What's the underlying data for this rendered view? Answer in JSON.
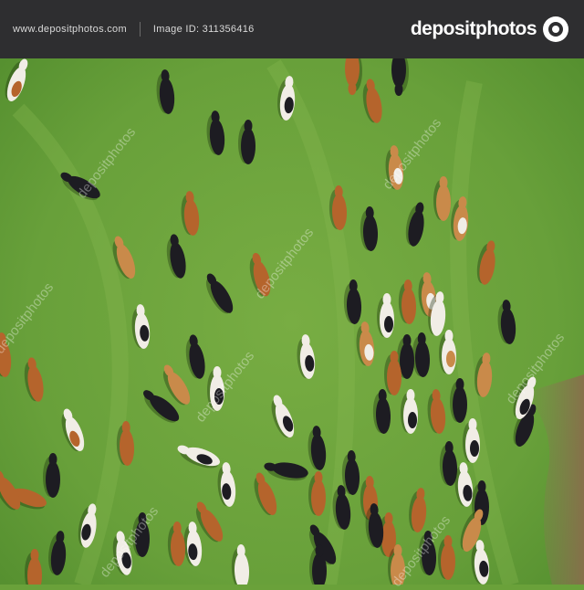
{
  "header": {
    "brand": "depositphotos",
    "image_id": "Image ID: 311356416",
    "site_url": "www.depositphotos.com"
  },
  "watermark": {
    "text": "depositphotos"
  },
  "colors": {
    "bar_bg": "#2e2e30",
    "grass": "#6aa13a",
    "cow_black": "#1d1c22",
    "cow_brown": "#b5642c",
    "cow_tan": "#c98a4a",
    "cow_white": "#f1ede6"
  },
  "photo": {
    "subject": "aerial view of a cattle herd grazing on a green pasture",
    "cow_count_estimate": 95
  }
}
